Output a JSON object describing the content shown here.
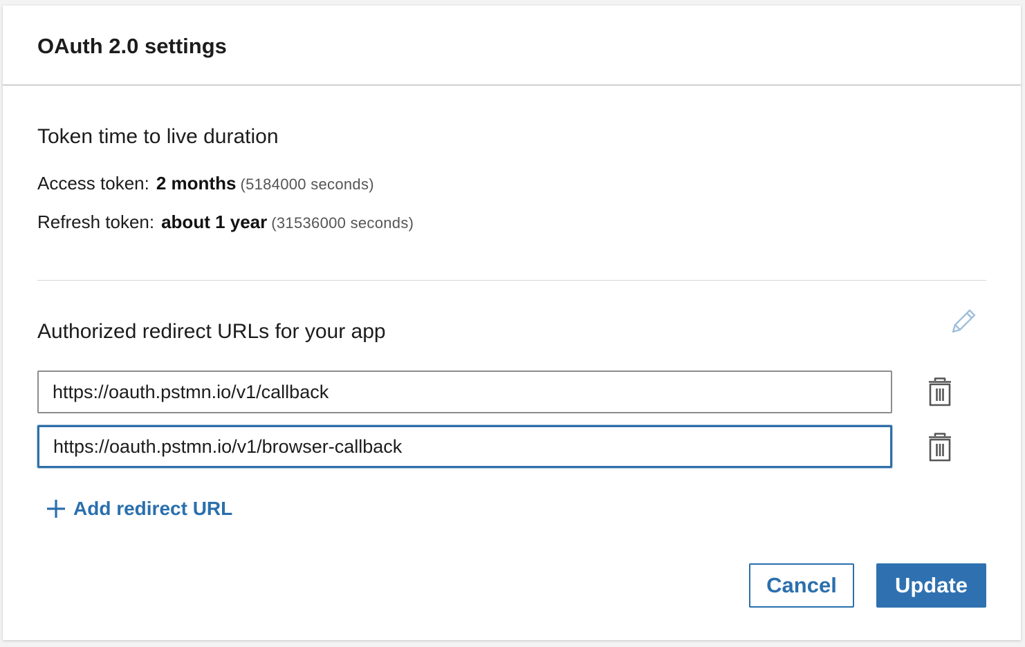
{
  "dialog": {
    "title": "OAuth 2.0 settings"
  },
  "token_ttl": {
    "section_title": "Token time to live duration",
    "access": {
      "label": "Access token:",
      "value": "2 months",
      "seconds": "(5184000 seconds)"
    },
    "refresh": {
      "label": "Refresh token:",
      "value": "about 1 year",
      "seconds": "(31536000 seconds)"
    }
  },
  "redirects": {
    "section_title": "Authorized redirect URLs for your app",
    "urls": [
      "https://oauth.pstmn.io/v1/callback",
      "https://oauth.pstmn.io/v1/browser-callback"
    ],
    "add_label": "Add redirect URL",
    "edit_icon": "pencil-icon",
    "delete_icon": "trash-icon"
  },
  "actions": {
    "cancel_label": "Cancel",
    "update_label": "Update"
  },
  "colors": {
    "accent": "#2f71b0",
    "link": "#2a6fad",
    "focus_border": "#2f6fa8",
    "pencil": "#9fbfdc"
  }
}
